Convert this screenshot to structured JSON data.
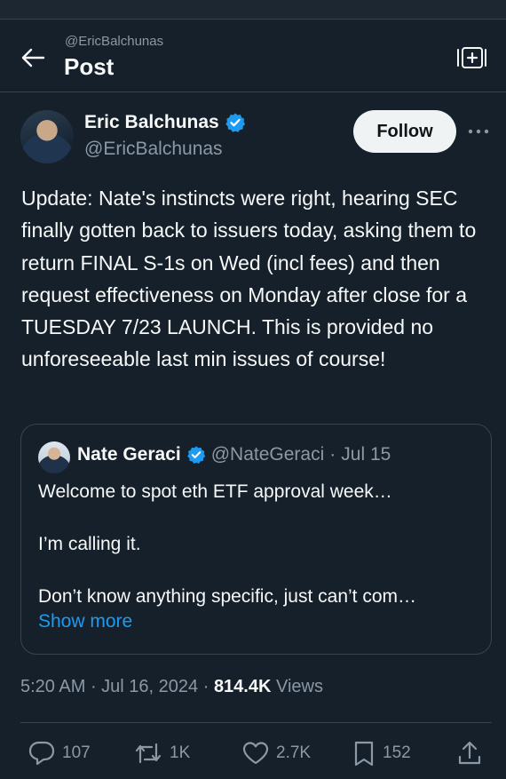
{
  "header": {
    "handle": "@EricBalchunas",
    "title": "Post"
  },
  "author": {
    "name": "Eric Balchunas",
    "handle": "@EricBalchunas",
    "verified": true,
    "follow_label": "Follow",
    "more_label": "···"
  },
  "tweet": {
    "text": "Update: Nate's instincts were right, hearing SEC finally gotten back to issuers today, asking them to return FINAL S-1s on Wed (incl fees) and then request effectiveness on Monday after close for a TUESDAY 7/23 LAUNCH. This is provided no unforeseeable last min issues of course!",
    "time": "5:20 AM",
    "date": "Jul 16, 2024",
    "views_count": "814.4K",
    "views_label": "Views"
  },
  "quote": {
    "name": "Nate Geraci",
    "handle": "@NateGeraci",
    "date": "Jul 15",
    "line1": "Welcome to spot eth ETF approval week…",
    "line2": "I’m calling it.",
    "line3": "Don’t know anything specific, just can’t com…",
    "show_more": "Show more"
  },
  "actions": {
    "replies": "107",
    "reposts": "1K",
    "likes": "2.7K",
    "bookmarks": "152"
  },
  "colors": {
    "background": "#15202b",
    "border": "#38444d",
    "secondary_text": "#8b98a5",
    "link": "#1d9bf0",
    "verified": "#1d9bf0"
  }
}
